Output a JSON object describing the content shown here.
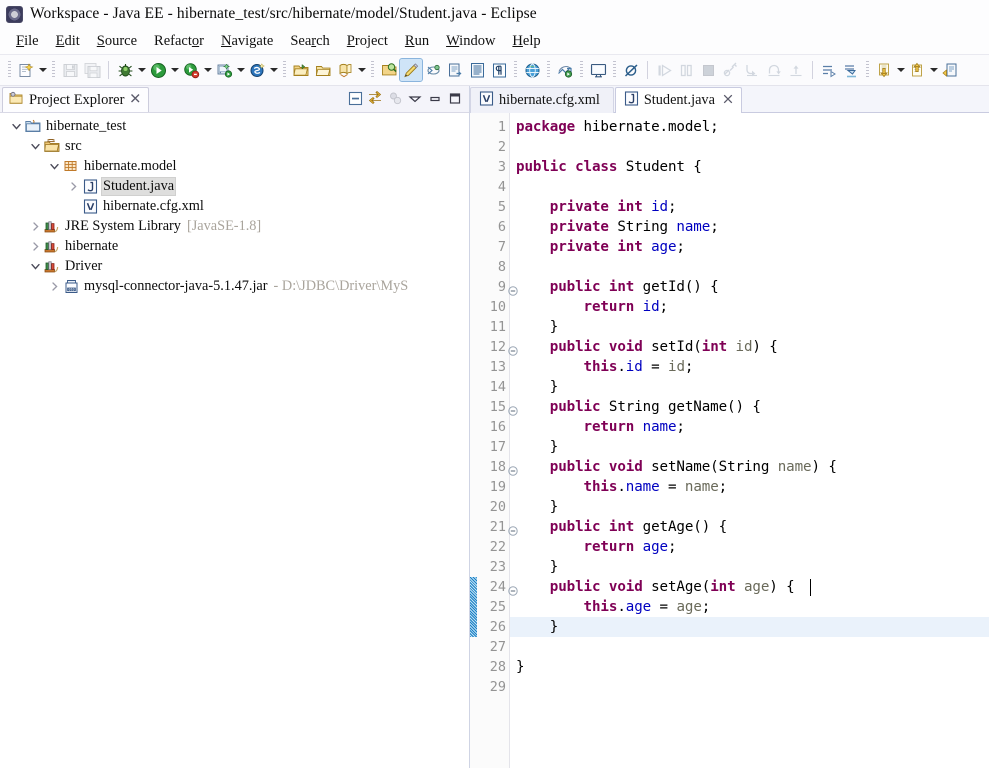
{
  "window": {
    "title": "Workspace - Java EE - hibernate_test/src/hibernate/model/Student.java - Eclipse",
    "app_icon": "eclipse-logo-icon"
  },
  "menubar": {
    "items": [
      {
        "label": "File",
        "mnemonic_index": 0
      },
      {
        "label": "Edit",
        "mnemonic_index": 0
      },
      {
        "label": "Source",
        "mnemonic_index": 0
      },
      {
        "label": "Refactor",
        "mnemonic_index": 6
      },
      {
        "label": "Navigate",
        "mnemonic_index": 0
      },
      {
        "label": "Search",
        "mnemonic_index": 3
      },
      {
        "label": "Project",
        "mnemonic_index": 0
      },
      {
        "label": "Run",
        "mnemonic_index": 0
      },
      {
        "label": "Window",
        "mnemonic_index": 0
      },
      {
        "label": "Help",
        "mnemonic_index": 0
      }
    ]
  },
  "toolbar": {
    "groups": [
      {
        "buttons": [
          {
            "name": "new-wizard-icon",
            "tooltip": "New",
            "dropdown": true,
            "enabled": true
          }
        ]
      },
      {
        "buttons": [
          {
            "name": "save-icon",
            "tooltip": "Save",
            "dropdown": false,
            "enabled": false
          },
          {
            "name": "save-all-icon",
            "tooltip": "Save All",
            "dropdown": false,
            "enabled": false
          }
        ]
      },
      {
        "buttons": [
          {
            "name": "debug-icon",
            "tooltip": "Debug",
            "dropdown": true,
            "enabled": true
          },
          {
            "name": "run-icon",
            "tooltip": "Run",
            "dropdown": true,
            "enabled": true
          },
          {
            "name": "run-coverage-icon",
            "tooltip": "Coverage",
            "dropdown": true,
            "enabled": true
          },
          {
            "name": "run-server-icon",
            "tooltip": "Run on Server",
            "dropdown": true,
            "enabled": true
          },
          {
            "name": "new-server-icon",
            "tooltip": "New Server",
            "dropdown": true,
            "enabled": true
          }
        ]
      },
      {
        "buttons": [
          {
            "name": "open-type-icon",
            "tooltip": "Open Type",
            "dropdown": false,
            "enabled": true
          },
          {
            "name": "open-task-icon",
            "tooltip": "Open Task",
            "dropdown": false,
            "enabled": true
          },
          {
            "name": "new-java-class-icon",
            "tooltip": "New Java Class",
            "dropdown": true,
            "enabled": true
          }
        ]
      },
      {
        "buttons": [
          {
            "name": "search-icon",
            "tooltip": "Search",
            "dropdown": false,
            "enabled": true
          },
          {
            "name": "toggle-mark-occurrences-icon",
            "tooltip": "Toggle Mark Occurrences",
            "dropdown": false,
            "enabled": true,
            "active": true
          },
          {
            "name": "link-editor-icon",
            "tooltip": "Link with Editor",
            "dropdown": false,
            "enabled": true
          },
          {
            "name": "next-annotation-icon",
            "tooltip": "Next Annotation",
            "dropdown": false,
            "enabled": true
          },
          {
            "name": "show-whitespace-icon",
            "tooltip": "Show Whitespace Characters",
            "dropdown": false,
            "enabled": true
          },
          {
            "name": "paragraph-mark-icon",
            "tooltip": "Show Paragraph Marks",
            "dropdown": false,
            "enabled": true
          }
        ]
      },
      {
        "buttons": [
          {
            "name": "web-browser-icon",
            "tooltip": "Open Web Browser",
            "dropdown": false,
            "enabled": true
          }
        ]
      },
      {
        "buttons": [
          {
            "name": "publish-icon",
            "tooltip": "Publish",
            "dropdown": false,
            "enabled": true
          }
        ]
      },
      {
        "buttons": [
          {
            "name": "terminal-icon",
            "tooltip": "Terminal",
            "dropdown": false,
            "enabled": true
          }
        ]
      },
      {
        "buttons": [
          {
            "name": "skip-breakpoints-icon",
            "tooltip": "Skip All Breakpoints",
            "dropdown": false,
            "enabled": true
          }
        ]
      },
      {
        "buttons": [
          {
            "name": "resume-icon",
            "tooltip": "Resume",
            "dropdown": false,
            "enabled": false
          },
          {
            "name": "suspend-icon",
            "tooltip": "Suspend",
            "dropdown": false,
            "enabled": false
          },
          {
            "name": "terminate-icon",
            "tooltip": "Terminate",
            "dropdown": false,
            "enabled": false
          },
          {
            "name": "disconnect-icon",
            "tooltip": "Disconnect",
            "dropdown": false,
            "enabled": false
          },
          {
            "name": "step-into-icon",
            "tooltip": "Step Into",
            "dropdown": false,
            "enabled": false
          },
          {
            "name": "step-over-icon",
            "tooltip": "Step Over",
            "dropdown": false,
            "enabled": false
          },
          {
            "name": "step-return-icon",
            "tooltip": "Step Return",
            "dropdown": false,
            "enabled": false
          }
        ]
      },
      {
        "buttons": [
          {
            "name": "last-edit-location-icon",
            "tooltip": "Last Edit Location",
            "dropdown": false,
            "enabled": true
          },
          {
            "name": "next-edit-icon",
            "tooltip": "Next Edit",
            "dropdown": false,
            "enabled": true
          }
        ]
      },
      {
        "buttons": [
          {
            "name": "back-history-icon",
            "tooltip": "Back",
            "dropdown": true,
            "enabled": true
          },
          {
            "name": "forward-history-icon",
            "tooltip": "Forward",
            "dropdown": true,
            "enabled": true
          },
          {
            "name": "previous-annotation-icon",
            "tooltip": "Previous Annotation",
            "dropdown": false,
            "enabled": true
          }
        ]
      }
    ]
  },
  "project_explorer": {
    "tab_label": "Project Explorer",
    "tab_icon": "project-explorer-icon",
    "tab_close_icon": "close-icon",
    "actions": [
      {
        "name": "collapse-all-icon",
        "label": "Collapse All",
        "enabled": true
      },
      {
        "name": "link-with-editor-icon",
        "label": "Link With Editor",
        "enabled": true
      },
      {
        "name": "view-menu-focus-icon",
        "label": "Focus On Active Task",
        "enabled": false
      },
      {
        "name": "view-menu-icon",
        "label": "View Menu",
        "enabled": true
      },
      {
        "name": "minimize-icon",
        "label": "Minimize",
        "enabled": true
      },
      {
        "name": "maximize-icon",
        "label": "Maximize",
        "enabled": true
      }
    ],
    "tree": [
      {
        "label": "hibernate_test",
        "indent": 0,
        "twisty": "expanded",
        "icon": "java-project-icon",
        "selected": false,
        "muted": ""
      },
      {
        "label": "src",
        "indent": 1,
        "twisty": "expanded",
        "icon": "source-folder-icon",
        "selected": false,
        "muted": ""
      },
      {
        "label": "hibernate.model",
        "indent": 2,
        "twisty": "expanded",
        "icon": "package-icon",
        "selected": false,
        "muted": ""
      },
      {
        "label": "Student.java",
        "indent": 3,
        "twisty": "collapsed",
        "icon": "java-file-icon",
        "selected": true,
        "muted": ""
      },
      {
        "label": "hibernate.cfg.xml",
        "indent": 3,
        "twisty": "none",
        "icon": "xml-file-icon",
        "selected": false,
        "muted": ""
      },
      {
        "label": "JRE System Library",
        "indent": 1,
        "twisty": "collapsed",
        "icon": "library-icon",
        "selected": false,
        "muted": "[JavaSE-1.8]"
      },
      {
        "label": "hibernate",
        "indent": 1,
        "twisty": "collapsed",
        "icon": "library-icon",
        "selected": false,
        "muted": ""
      },
      {
        "label": "Driver",
        "indent": 1,
        "twisty": "expanded",
        "icon": "library-icon",
        "selected": false,
        "muted": ""
      },
      {
        "label": "mysql-connector-java-5.1.47.jar",
        "indent": 2,
        "twisty": "collapsed",
        "icon": "jar-icon",
        "selected": false,
        "muted": "- D:\\JDBC\\Driver\\MyS"
      }
    ]
  },
  "editor": {
    "tabs": [
      {
        "label": "hibernate.cfg.xml",
        "icon": "xml-file-icon",
        "selected": false,
        "closable": false
      },
      {
        "label": "Student.java",
        "icon": "java-file-icon",
        "selected": true,
        "closable": true
      }
    ],
    "current_line": 26,
    "change_bar_lines": [
      24,
      25,
      26
    ],
    "fold_lines": [
      9,
      12,
      15,
      18,
      21,
      24
    ],
    "lines": [
      {
        "no": 1,
        "tokens": [
          {
            "t": "package ",
            "c": "kw"
          },
          {
            "t": "hibernate.model;",
            "c": "plain"
          }
        ]
      },
      {
        "no": 2,
        "tokens": []
      },
      {
        "no": 3,
        "tokens": [
          {
            "t": "public class ",
            "c": "kw"
          },
          {
            "t": "Student {",
            "c": "plain"
          }
        ]
      },
      {
        "no": 4,
        "tokens": []
      },
      {
        "no": 5,
        "tokens": [
          {
            "t": "    ",
            "c": "plain"
          },
          {
            "t": "private int ",
            "c": "kw"
          },
          {
            "t": "id",
            "c": "fld"
          },
          {
            "t": ";",
            "c": "plain"
          }
        ]
      },
      {
        "no": 6,
        "tokens": [
          {
            "t": "    ",
            "c": "plain"
          },
          {
            "t": "private ",
            "c": "kw"
          },
          {
            "t": "String ",
            "c": "plain"
          },
          {
            "t": "name",
            "c": "fld"
          },
          {
            "t": ";",
            "c": "plain"
          }
        ]
      },
      {
        "no": 7,
        "tokens": [
          {
            "t": "    ",
            "c": "plain"
          },
          {
            "t": "private int ",
            "c": "kw"
          },
          {
            "t": "age",
            "c": "fld"
          },
          {
            "t": ";",
            "c": "plain"
          }
        ]
      },
      {
        "no": 8,
        "tokens": []
      },
      {
        "no": 9,
        "tokens": [
          {
            "t": "    ",
            "c": "plain"
          },
          {
            "t": "public int ",
            "c": "kw"
          },
          {
            "t": "getId() {",
            "c": "plain"
          }
        ]
      },
      {
        "no": 10,
        "tokens": [
          {
            "t": "        ",
            "c": "plain"
          },
          {
            "t": "return ",
            "c": "kw"
          },
          {
            "t": "id",
            "c": "fld"
          },
          {
            "t": ";",
            "c": "plain"
          }
        ]
      },
      {
        "no": 11,
        "tokens": [
          {
            "t": "    }",
            "c": "plain"
          }
        ]
      },
      {
        "no": 12,
        "tokens": [
          {
            "t": "    ",
            "c": "plain"
          },
          {
            "t": "public void ",
            "c": "kw"
          },
          {
            "t": "setId(",
            "c": "plain"
          },
          {
            "t": "int ",
            "c": "kw"
          },
          {
            "t": "id",
            "c": "param"
          },
          {
            "t": ") {",
            "c": "plain"
          }
        ]
      },
      {
        "no": 13,
        "tokens": [
          {
            "t": "        ",
            "c": "plain"
          },
          {
            "t": "this",
            "c": "kw"
          },
          {
            "t": ".",
            "c": "plain"
          },
          {
            "t": "id",
            "c": "fld"
          },
          {
            "t": " = ",
            "c": "plain"
          },
          {
            "t": "id",
            "c": "param"
          },
          {
            "t": ";",
            "c": "plain"
          }
        ]
      },
      {
        "no": 14,
        "tokens": [
          {
            "t": "    }",
            "c": "plain"
          }
        ]
      },
      {
        "no": 15,
        "tokens": [
          {
            "t": "    ",
            "c": "plain"
          },
          {
            "t": "public ",
            "c": "kw"
          },
          {
            "t": "String getName() {",
            "c": "plain"
          }
        ]
      },
      {
        "no": 16,
        "tokens": [
          {
            "t": "        ",
            "c": "plain"
          },
          {
            "t": "return ",
            "c": "kw"
          },
          {
            "t": "name",
            "c": "fld"
          },
          {
            "t": ";",
            "c": "plain"
          }
        ]
      },
      {
        "no": 17,
        "tokens": [
          {
            "t": "    }",
            "c": "plain"
          }
        ]
      },
      {
        "no": 18,
        "tokens": [
          {
            "t": "    ",
            "c": "plain"
          },
          {
            "t": "public void ",
            "c": "kw"
          },
          {
            "t": "setName(String ",
            "c": "plain"
          },
          {
            "t": "name",
            "c": "param"
          },
          {
            "t": ") {",
            "c": "plain"
          }
        ]
      },
      {
        "no": 19,
        "tokens": [
          {
            "t": "        ",
            "c": "plain"
          },
          {
            "t": "this",
            "c": "kw"
          },
          {
            "t": ".",
            "c": "plain"
          },
          {
            "t": "name",
            "c": "fld"
          },
          {
            "t": " = ",
            "c": "plain"
          },
          {
            "t": "name",
            "c": "param"
          },
          {
            "t": ";",
            "c": "plain"
          }
        ]
      },
      {
        "no": 20,
        "tokens": [
          {
            "t": "    }",
            "c": "plain"
          }
        ]
      },
      {
        "no": 21,
        "tokens": [
          {
            "t": "    ",
            "c": "plain"
          },
          {
            "t": "public int ",
            "c": "kw"
          },
          {
            "t": "getAge() {",
            "c": "plain"
          }
        ]
      },
      {
        "no": 22,
        "tokens": [
          {
            "t": "        ",
            "c": "plain"
          },
          {
            "t": "return ",
            "c": "kw"
          },
          {
            "t": "age",
            "c": "fld"
          },
          {
            "t": ";",
            "c": "plain"
          }
        ]
      },
      {
        "no": 23,
        "tokens": [
          {
            "t": "    }",
            "c": "plain"
          }
        ]
      },
      {
        "no": 24,
        "tokens": [
          {
            "t": "    ",
            "c": "plain"
          },
          {
            "t": "public void ",
            "c": "kw"
          },
          {
            "t": "setAge(",
            "c": "plain"
          },
          {
            "t": "int ",
            "c": "kw"
          },
          {
            "t": "age",
            "c": "param"
          },
          {
            "t": ") {",
            "c": "plain"
          }
        ]
      },
      {
        "no": 25,
        "tokens": [
          {
            "t": "        ",
            "c": "plain"
          },
          {
            "t": "this",
            "c": "kw"
          },
          {
            "t": ".",
            "c": "plain"
          },
          {
            "t": "age",
            "c": "fld"
          },
          {
            "t": " = ",
            "c": "plain"
          },
          {
            "t": "age",
            "c": "param"
          },
          {
            "t": ";",
            "c": "plain"
          }
        ]
      },
      {
        "no": 26,
        "tokens": [
          {
            "t": "    }",
            "c": "plain"
          }
        ]
      },
      {
        "no": 27,
        "tokens": []
      },
      {
        "no": 28,
        "tokens": [
          {
            "t": "}",
            "c": "plain"
          }
        ]
      },
      {
        "no": 29,
        "tokens": []
      }
    ]
  },
  "colors": {
    "keyword": "#7f0055",
    "field": "#0000c0",
    "parameter": "#6a6a5a",
    "current_line_highlight": "#eaf2fb",
    "change_bar": "#1b7fc4",
    "selection": "#dededd",
    "muted_text": "#a9a49c"
  }
}
